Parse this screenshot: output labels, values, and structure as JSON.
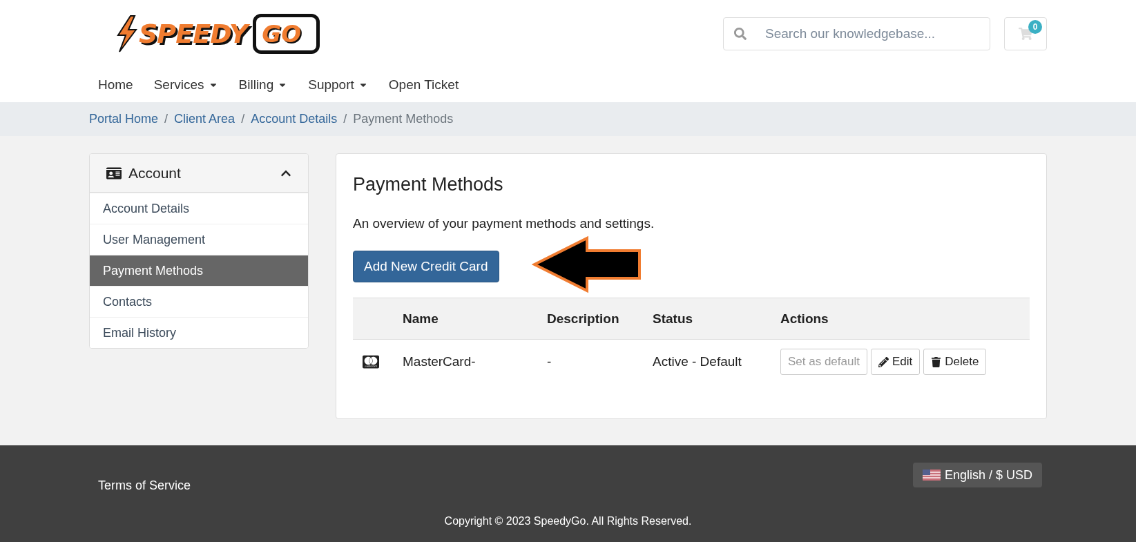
{
  "logo": {
    "text": "SPEEDY",
    "badge": "GO"
  },
  "search": {
    "placeholder": "Search our knowledgebase..."
  },
  "cart": {
    "count": "0"
  },
  "nav": [
    {
      "label": "Home",
      "dropdown": false
    },
    {
      "label": "Services",
      "dropdown": true
    },
    {
      "label": "Billing",
      "dropdown": true
    },
    {
      "label": "Support",
      "dropdown": true
    },
    {
      "label": "Open Ticket",
      "dropdown": false
    }
  ],
  "breadcrumb_separator": "/",
  "breadcrumb": [
    {
      "label": "Portal Home",
      "link": true
    },
    {
      "label": "Client Area",
      "link": true
    },
    {
      "label": "Account Details",
      "link": true
    },
    {
      "label": "Payment Methods",
      "link": false
    }
  ],
  "sidebar": {
    "title": "Account",
    "expanded": true,
    "items": [
      {
        "label": "Account Details",
        "selected": false
      },
      {
        "label": "User Management",
        "selected": false
      },
      {
        "label": "Payment Methods",
        "selected": true
      },
      {
        "label": "Contacts",
        "selected": false
      },
      {
        "label": "Email History",
        "selected": false
      }
    ]
  },
  "main": {
    "title": "Payment Methods",
    "description": "An overview of your payment methods and settings.",
    "add_button": "Add New Credit Card",
    "table": {
      "columns": [
        "Name",
        "Description",
        "Status",
        "Actions"
      ],
      "rows": [
        {
          "name": "MasterCard-",
          "description": "-",
          "status": "Active - Default",
          "actions": [
            {
              "label": "Set as default",
              "kind": "default",
              "disabled": true
            },
            {
              "label": "Edit",
              "kind": "edit",
              "disabled": false
            },
            {
              "label": "Delete",
              "kind": "delete",
              "disabled": false
            }
          ]
        }
      ]
    }
  },
  "footer": {
    "links": [
      "Terms of Service"
    ],
    "language": "English / $ USD",
    "copyright": "Copyright © 2023 SpeedyGo. All Rights Reserved."
  }
}
